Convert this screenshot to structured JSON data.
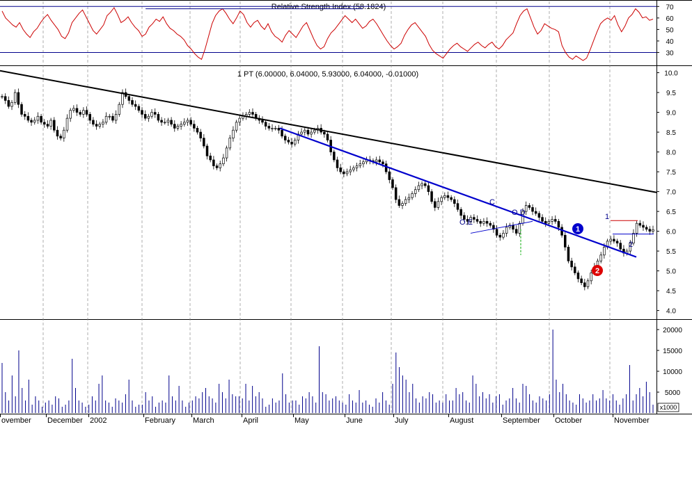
{
  "chart_data": [
    {
      "type": "line",
      "panel": "rsi",
      "title": "Relative Strength Index (58.1824)",
      "y_ticks": [
        30,
        40,
        50,
        60,
        70
      ],
      "hlines": [
        70,
        30
      ],
      "ylim": [
        20,
        72
      ],
      "series": [
        {
          "name": "",
          "color": "#cc0000",
          "values": [
            66,
            60,
            57,
            54,
            52,
            56,
            50,
            46,
            43,
            48,
            51,
            56,
            60,
            63,
            58,
            54,
            50,
            44,
            42,
            47,
            56,
            60,
            64,
            67,
            61,
            55,
            49,
            46,
            50,
            54,
            62,
            65,
            69,
            63,
            56,
            58,
            61,
            56,
            52,
            49,
            44,
            46,
            52,
            55,
            59,
            57,
            61,
            55,
            51,
            49,
            46,
            44,
            41,
            36,
            33,
            29,
            26,
            24,
            33,
            44,
            55,
            62,
            66,
            68,
            64,
            59,
            55,
            60,
            66,
            63,
            56,
            52,
            56,
            58,
            53,
            50,
            55,
            48,
            44,
            42,
            39,
            45,
            49,
            46,
            43,
            48,
            53,
            56,
            49,
            42,
            36,
            33,
            35,
            42,
            47,
            50,
            54,
            58,
            62,
            59,
            56,
            59,
            55,
            51,
            53,
            57,
            59,
            55,
            50,
            45,
            40,
            36,
            33,
            35,
            38,
            45,
            50,
            54,
            56,
            52,
            48,
            44,
            37,
            32,
            29,
            27,
            25,
            29,
            33,
            36,
            38,
            35,
            33,
            31,
            34,
            37,
            39,
            36,
            34,
            37,
            39,
            35,
            33,
            36,
            41,
            44,
            47,
            55,
            62,
            66,
            68,
            60,
            52,
            46,
            49,
            55,
            53,
            51,
            50,
            48,
            36,
            30,
            26,
            24,
            27,
            25,
            23,
            25,
            32,
            40,
            48,
            55,
            58,
            60,
            58,
            62,
            54,
            48,
            53,
            60,
            63,
            68,
            65,
            60,
            61,
            58,
            59
          ]
        }
      ],
      "trendlines": [
        {
          "name": "",
          "color": "#00008b",
          "x": [
            41,
            103
          ],
          "y": [
            68,
            68
          ]
        },
        {
          "name": "",
          "color": "#00008b",
          "x": [
            217,
            251
          ],
          "y": [
            43,
            46
          ]
        },
        {
          "name": "",
          "color": "#00008b",
          "x": [
            263,
            307
          ],
          "y": [
            40,
            64
          ]
        }
      ]
    },
    {
      "type": "candlestick",
      "panel": "price",
      "title": "1 PT (6.00000, 6.04000, 5.93000, 6.04000, -0.01000)",
      "y_ticks": [
        4.0,
        4.5,
        5.0,
        5.5,
        6.0,
        6.5,
        7.0,
        7.5,
        8.0,
        8.5,
        9.0,
        9.5,
        10.0
      ],
      "ylim": [
        3.8,
        10.15
      ],
      "ohlc_close": [
        9.4,
        9.3,
        9.15,
        9.25,
        9.5,
        9.2,
        8.95,
        8.9,
        8.8,
        8.75,
        8.8,
        8.9,
        8.75,
        8.7,
        8.65,
        8.8,
        8.55,
        8.4,
        8.35,
        8.55,
        8.85,
        9.05,
        9.1,
        9.0,
        8.95,
        9.05,
        8.95,
        8.8,
        8.7,
        8.65,
        8.7,
        8.75,
        8.9,
        8.9,
        8.8,
        8.95,
        9.2,
        9.5,
        9.4,
        9.3,
        9.2,
        9.15,
        9.05,
        8.95,
        8.85,
        8.9,
        9.0,
        8.95,
        8.8,
        8.75,
        8.75,
        8.8,
        8.7,
        8.6,
        8.65,
        8.7,
        8.75,
        8.8,
        8.7,
        8.6,
        8.5,
        8.35,
        8.15,
        7.9,
        7.8,
        7.65,
        7.6,
        7.7,
        7.85,
        8.1,
        8.35,
        8.55,
        8.75,
        8.85,
        8.9,
        8.95,
        9.0,
        8.95,
        8.85,
        8.8,
        8.75,
        8.65,
        8.6,
        8.6,
        8.6,
        8.55,
        8.4,
        8.3,
        8.25,
        8.2,
        8.3,
        8.45,
        8.5,
        8.55,
        8.45,
        8.5,
        8.55,
        8.6,
        8.5,
        8.45,
        8.3,
        8.0,
        7.8,
        7.6,
        7.5,
        7.45,
        7.5,
        7.55,
        7.6,
        7.65,
        7.7,
        7.75,
        7.8,
        7.78,
        7.75,
        7.8,
        7.75,
        7.7,
        7.5,
        7.3,
        7.1,
        6.8,
        6.65,
        6.7,
        6.8,
        6.85,
        6.95,
        7.05,
        7.15,
        7.2,
        7.15,
        7.0,
        6.75,
        6.6,
        6.75,
        6.85,
        6.9,
        6.85,
        6.8,
        6.7,
        6.55,
        6.4,
        6.3,
        6.25,
        6.35,
        6.3,
        6.25,
        6.2,
        6.25,
        6.2,
        6.15,
        6.05,
        5.9,
        5.85,
        5.95,
        6.1,
        6.15,
        6.05,
        5.95,
        6.2,
        6.5,
        6.65,
        6.6,
        6.5,
        6.45,
        6.35,
        6.25,
        6.2,
        6.25,
        6.3,
        6.25,
        6.1,
        5.9,
        5.6,
        5.25,
        5.1,
        4.95,
        4.8,
        4.7,
        4.6,
        4.75,
        4.95,
        5.1,
        5.25,
        5.4,
        5.6,
        5.75,
        5.8,
        5.75,
        5.7,
        5.55,
        5.45,
        5.5,
        5.7,
        5.95,
        6.2,
        6.15,
        6.1,
        6.05,
        6.0,
        6.04
      ]
    },
    {
      "type": "bar",
      "panel": "volume",
      "unit_label": "x1000",
      "y_ticks": [
        5000,
        10000,
        15000,
        20000
      ],
      "ylim": [
        0,
        22000
      ],
      "values": [
        12000,
        5000,
        3000,
        9000,
        4000,
        15000,
        6000,
        3000,
        8000,
        2000,
        4000,
        3000,
        1500,
        2500,
        3000,
        2000,
        4000,
        3500,
        1500,
        2000,
        3000,
        13000,
        6000,
        3000,
        2500,
        1500,
        2000,
        4000,
        3000,
        7000,
        9000,
        3000,
        2500,
        1500,
        3500,
        3000,
        2500,
        4500,
        8000,
        3000,
        1500,
        2000,
        2000,
        5000,
        3000,
        4000,
        1500,
        2500,
        3000,
        2500,
        9000,
        4000,
        3000,
        6500,
        3000,
        1500,
        2500,
        3000,
        4000,
        3500,
        5000,
        6000,
        4000,
        3500,
        2500,
        7000,
        5000,
        3500,
        8000,
        4500,
        4000,
        4000,
        3500,
        7000,
        3000,
        6500,
        4000,
        5000,
        3500,
        1500,
        2000,
        3500,
        2500,
        3000,
        9500,
        4500,
        2500,
        3000,
        3000,
        2000,
        4000,
        3500,
        5000,
        4000,
        2500,
        16000,
        5000,
        4500,
        3000,
        3500,
        4000,
        3000,
        2500,
        2000,
        4500,
        3000,
        2500,
        5500,
        2500,
        3000,
        2000,
        1500,
        3500,
        2500,
        5000,
        3000,
        2000,
        7000,
        14500,
        11000,
        9000,
        8000,
        5000,
        7000,
        3500,
        2500,
        4000,
        3500,
        5000,
        4500,
        2500,
        3000,
        2500,
        4500,
        3000,
        3000,
        6000,
        4500,
        5000,
        3000,
        2500,
        9000,
        7000,
        4000,
        5000,
        3500,
        4500,
        2500,
        4000,
        4500,
        2000,
        3000,
        3500,
        6000,
        3500,
        2500,
        7000,
        6500,
        4500,
        3000,
        2500,
        4000,
        3500,
        3000,
        4500,
        20000,
        8000,
        5000,
        7000,
        4500,
        3000,
        2500,
        2000,
        4500,
        3500,
        2500,
        3000,
        4500,
        3000,
        3500,
        5500,
        3500,
        3000,
        4500,
        3000,
        2000,
        3500,
        4500,
        11500,
        3000,
        4500,
        6000,
        4000,
        7500,
        5000,
        2000
      ]
    }
  ],
  "annotations": {
    "oe": "O.E",
    "c": "C",
    "od": "O.D",
    "mark_1": "1",
    "mark_2": "2",
    "circle_1": "1",
    "circle_2": "2"
  },
  "x_axis": {
    "months": [
      "ovember",
      "December",
      "2002",
      "February",
      "March",
      "April",
      "May",
      "June",
      "July",
      "August",
      "September",
      "October",
      "November"
    ]
  },
  "colors": {
    "axis_line": "#00008b",
    "rsi_line": "#cc0000",
    "candles": "#000000",
    "volume_bars": "#00008b",
    "blue_trend": "#0000cc",
    "black_trend": "#000000",
    "circle_blue": "#0000cc",
    "circle_red": "#dd0000"
  }
}
